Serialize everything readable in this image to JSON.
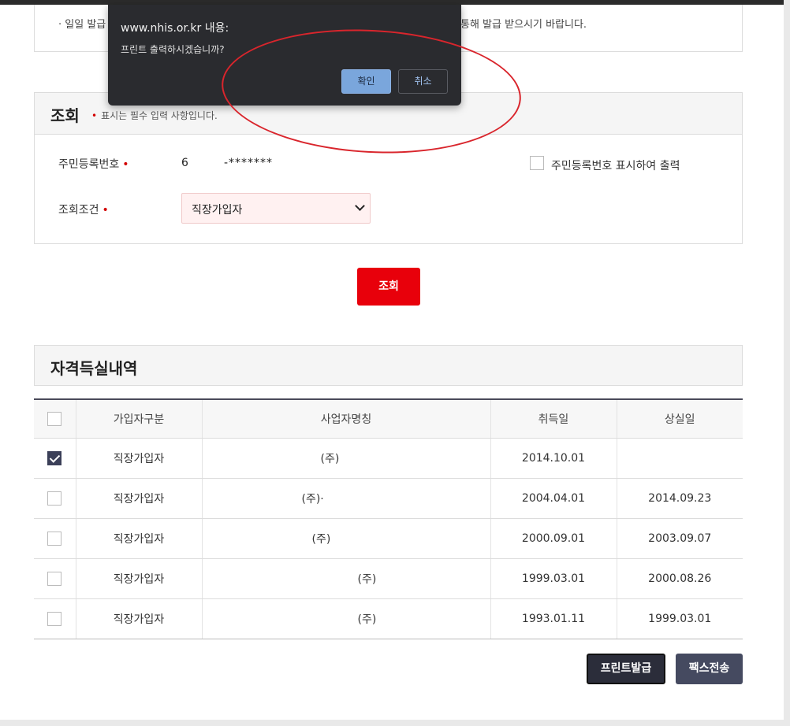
{
  "notice": {
    "bullet": "·",
    "left_text": "일일 발급",
    "right_text": "통해 발급 받으시기 바랍니다."
  },
  "search": {
    "title": "조회",
    "required_note": "표시는 필수 입력 사항입니다.",
    "required_mark": "•",
    "rrn_label": "주민등록번호",
    "rrn_front": "6",
    "rrn_back": "-*******",
    "show_rrn_label": "주민등록번호 표시하여 출력",
    "condition_label": "조회조건",
    "condition_value": "직장가입자",
    "query_button": "조회"
  },
  "history": {
    "title": "자격득실내역",
    "columns": [
      "가입자구분",
      "사업자명칭",
      "취득일",
      "상실일"
    ],
    "rows": [
      {
        "checked": true,
        "type": "직장가입자",
        "company": "(주)",
        "acquired": "2014.10.01",
        "lost": ""
      },
      {
        "checked": false,
        "type": "직장가입자",
        "company": "(주)·",
        "acquired": "2004.04.01",
        "lost": "2014.09.23"
      },
      {
        "checked": false,
        "type": "직장가입자",
        "company": "(주)",
        "acquired": "2000.09.01",
        "lost": "2003.09.07"
      },
      {
        "checked": false,
        "type": "직장가입자",
        "company": "(주)",
        "acquired": "1999.03.01",
        "lost": "2000.08.26"
      },
      {
        "checked": false,
        "type": "직장가입자",
        "company": "(주)",
        "acquired": "1993.01.11",
        "lost": "1999.03.01"
      }
    ]
  },
  "actions": {
    "print": "프린트발급",
    "fax": "팩스전송"
  },
  "dialog": {
    "title": "www.nhis.or.kr 내용:",
    "message": "프린트 출력하시겠습니까?",
    "ok": "확인",
    "cancel": "취소"
  },
  "colors": {
    "accent_red": "#e8000b",
    "dark_button": "#2b2d3a",
    "dialog_bg": "#2a2b2f",
    "annotation": "#d9252c"
  }
}
